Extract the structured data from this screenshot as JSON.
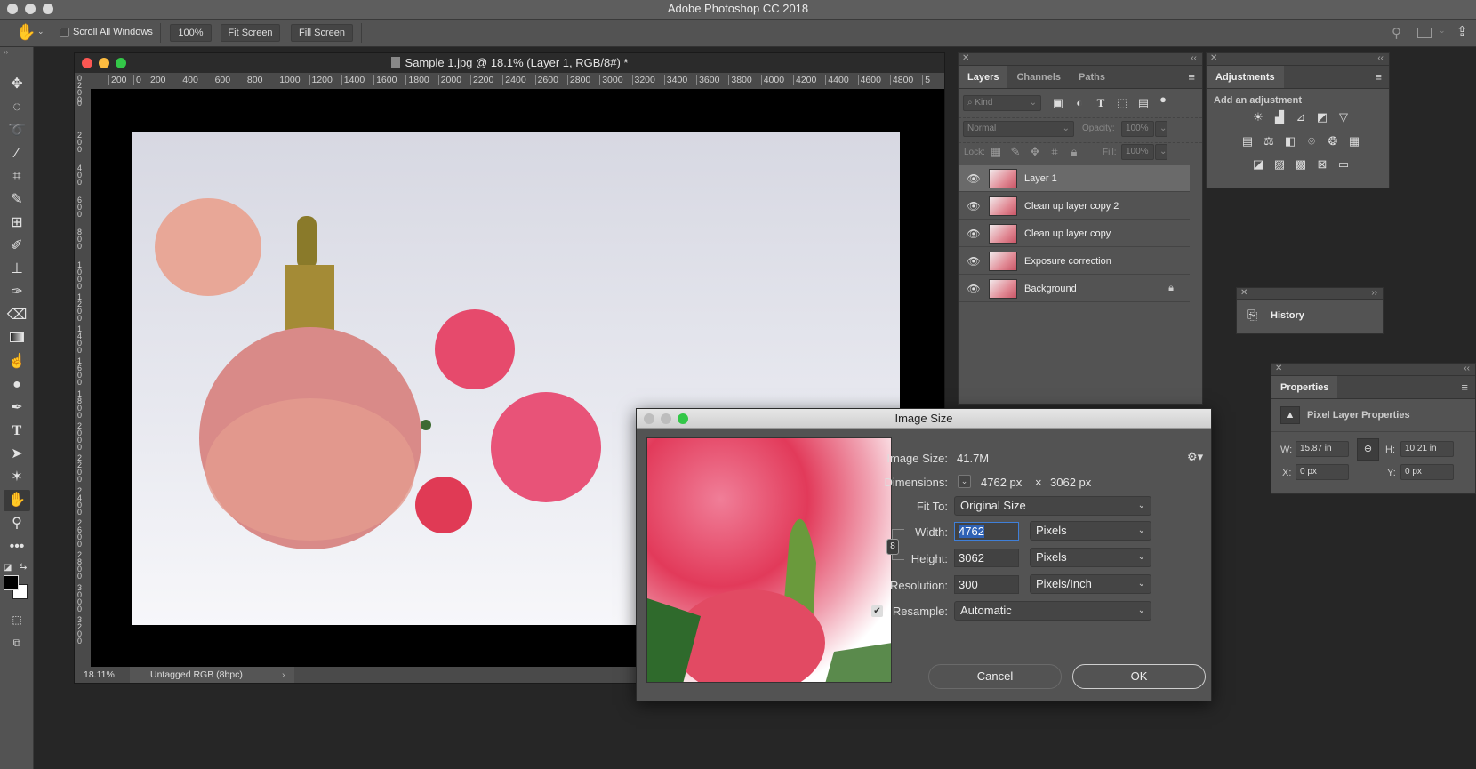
{
  "app": {
    "title": "Adobe Photoshop CC 2018"
  },
  "options_bar": {
    "tool_icon": "hand-icon",
    "scroll_all_windows_label": "Scroll All Windows",
    "scroll_all_windows_checked": false,
    "zoom_100_label": "100%",
    "fit_screen_label": "Fit Screen",
    "fill_screen_label": "Fill Screen"
  },
  "tools": [
    "move",
    "marquee",
    "lasso",
    "magic-wand",
    "crop",
    "eyedropper",
    "frame",
    "brush",
    "stamp",
    "history-brush",
    "eraser",
    "gradient",
    "smudge",
    "dodge",
    "pen",
    "type",
    "path-select",
    "shape",
    "hand",
    "zoom",
    "more"
  ],
  "document": {
    "title": "Sample 1.jpg @ 18.1% (Layer 1, RGB/8#) *",
    "ruler_h": [
      "200",
      "0",
      "200",
      "400",
      "600",
      "800",
      "1000",
      "1200",
      "1400",
      "1600",
      "1800",
      "2000",
      "2200",
      "2400",
      "2600",
      "2800",
      "3000",
      "3200",
      "3400",
      "3600",
      "3800",
      "4000",
      "4200",
      "4400",
      "4600",
      "4800",
      "5"
    ],
    "ruler_v": [
      "0",
      "200",
      "0",
      "200",
      "400",
      "600",
      "800",
      "1000",
      "1200",
      "1400",
      "1600",
      "1800",
      "2000",
      "2200",
      "2400",
      "2600",
      "2800",
      "3000",
      "3200"
    ],
    "zoom": "18.11%",
    "color_profile": "Untagged RGB (8bpc)"
  },
  "layers_panel": {
    "tabs": [
      "Layers",
      "Channels",
      "Paths"
    ],
    "kind_label": "Kind",
    "blend_mode": "Normal",
    "opacity_label": "Opacity:",
    "opacity_value": "100%",
    "lock_label": "Lock:",
    "fill_label": "Fill:",
    "fill_value": "100%",
    "layers": [
      {
        "name": "Layer 1",
        "selected": true,
        "locked": false
      },
      {
        "name": "Clean up layer copy 2",
        "selected": false,
        "locked": false
      },
      {
        "name": "Clean up layer copy",
        "selected": false,
        "locked": false
      },
      {
        "name": "Exposure correction",
        "selected": false,
        "locked": false
      },
      {
        "name": "Background",
        "selected": false,
        "locked": true
      }
    ]
  },
  "adjustments_panel": {
    "title": "Adjustments",
    "subtitle": "Add an adjustment"
  },
  "history_panel": {
    "title": "History"
  },
  "properties_panel": {
    "title": "Properties",
    "subtitle": "Pixel Layer Properties",
    "w_label": "W:",
    "w_value": "15.87 in",
    "h_label": "H:",
    "h_value": "10.21 in",
    "x_label": "X:",
    "x_value": "0 px",
    "y_label": "Y:",
    "y_value": "0 px"
  },
  "image_size_dialog": {
    "title": "Image Size",
    "image_size_label": "Image Size:",
    "image_size_value": "41.7M",
    "dimensions_label": "Dimensions:",
    "dimensions_w": "4762 px",
    "dimensions_x": "×",
    "dimensions_h": "3062 px",
    "fit_to_label": "Fit To:",
    "fit_to_value": "Original Size",
    "width_label": "Width:",
    "width_value": "4762",
    "width_unit": "Pixels",
    "height_label": "Height:",
    "height_value": "3062",
    "height_unit": "Pixels",
    "resolution_label": "Resolution:",
    "resolution_value": "300",
    "resolution_unit": "Pixels/Inch",
    "resample_label": "Resample:",
    "resample_checked": true,
    "resample_value": "Automatic",
    "cancel_label": "Cancel",
    "ok_label": "OK"
  }
}
